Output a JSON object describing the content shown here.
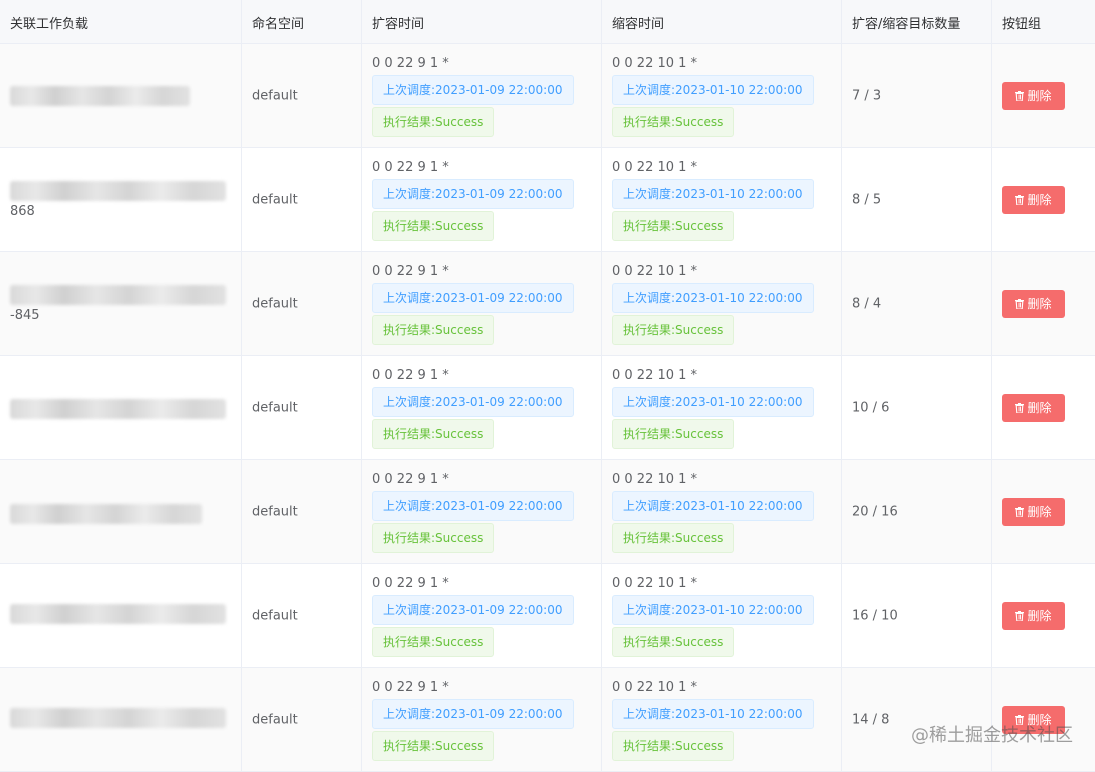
{
  "table": {
    "headers": [
      "关联工作负载",
      "命名空间",
      "扩容时间",
      "缩容时间",
      "扩容/缩容目标数量",
      "按钮组"
    ],
    "rows": [
      {
        "workload_suffix": "",
        "namespace": "default",
        "scale_up": {
          "cron": "0 0 22 9 1 *",
          "last": "上次调度:2023-01-09 22:00:00",
          "result": "执行结果:Success"
        },
        "scale_down": {
          "cron": "0 0 22 10 1 *",
          "last": "上次调度:2023-01-10 22:00:00",
          "result": "执行结果:Success"
        },
        "target": "7 / 3",
        "delete_label": "删除"
      },
      {
        "workload_suffix": "868",
        "namespace": "default",
        "scale_up": {
          "cron": "0 0 22 9 1 *",
          "last": "上次调度:2023-01-09 22:00:00",
          "result": "执行结果:Success"
        },
        "scale_down": {
          "cron": "0 0 22 10 1 *",
          "last": "上次调度:2023-01-10 22:00:00",
          "result": "执行结果:Success"
        },
        "target": "8 / 5",
        "delete_label": "删除"
      },
      {
        "workload_suffix": "-845",
        "namespace": "default",
        "scale_up": {
          "cron": "0 0 22 9 1 *",
          "last": "上次调度:2023-01-09 22:00:00",
          "result": "执行结果:Success"
        },
        "scale_down": {
          "cron": "0 0 22 10 1 *",
          "last": "上次调度:2023-01-10 22:00:00",
          "result": "执行结果:Success"
        },
        "target": "8 / 4",
        "delete_label": "删除"
      },
      {
        "workload_suffix": "",
        "namespace": "default",
        "scale_up": {
          "cron": "0 0 22 9 1 *",
          "last": "上次调度:2023-01-09 22:00:00",
          "result": "执行结果:Success"
        },
        "scale_down": {
          "cron": "0 0 22 10 1 *",
          "last": "上次调度:2023-01-10 22:00:00",
          "result": "执行结果:Success"
        },
        "target": "10 / 6",
        "delete_label": "删除"
      },
      {
        "workload_suffix": "",
        "namespace": "default",
        "scale_up": {
          "cron": "0 0 22 9 1 *",
          "last": "上次调度:2023-01-09 22:00:00",
          "result": "执行结果:Success"
        },
        "scale_down": {
          "cron": "0 0 22 10 1 *",
          "last": "上次调度:2023-01-10 22:00:00",
          "result": "执行结果:Success"
        },
        "target": "20 / 16",
        "delete_label": "删除"
      },
      {
        "workload_suffix": "",
        "namespace": "default",
        "scale_up": {
          "cron": "0 0 22 9 1 *",
          "last": "上次调度:2023-01-09 22:00:00",
          "result": "执行结果:Success"
        },
        "scale_down": {
          "cron": "0 0 22 10 1 *",
          "last": "上次调度:2023-01-10 22:00:00",
          "result": "执行结果:Success"
        },
        "target": "16 / 10",
        "delete_label": "删除"
      },
      {
        "workload_suffix": "",
        "namespace": "default",
        "scale_up": {
          "cron": "0 0 22 9 1 *",
          "last": "上次调度:2023-01-09 22:00:00",
          "result": "执行结果:Success"
        },
        "scale_down": {
          "cron": "0 0 22 10 1 *",
          "last": "上次调度:2023-01-10 22:00:00",
          "result": "执行结果:Success"
        },
        "target": "14 / 8",
        "delete_label": "删除"
      }
    ]
  },
  "watermark": "@稀土掘金技术社区",
  "colors": {
    "delete_button": "#f56c6c",
    "info_tag": "#409eff",
    "success_tag": "#67c23a",
    "header_bg": "#f7f8fa"
  },
  "icons": {
    "delete": "trash-icon"
  }
}
